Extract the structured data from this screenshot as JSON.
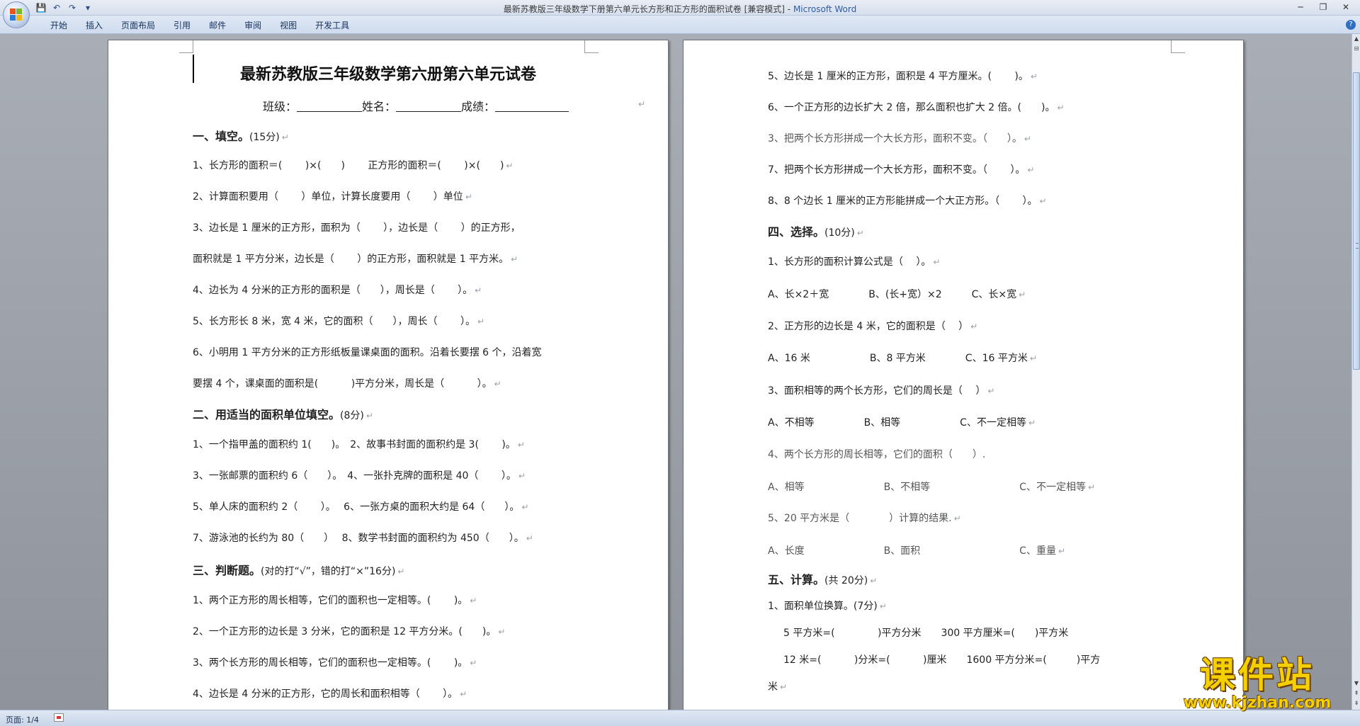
{
  "window": {
    "title": "最新苏教版三年级数学下册第六单元长方形和正方形的面积试卷 [兼容模式]",
    "app_sep": " - ",
    "app_name": "Microsoft Word",
    "qat": [
      "💾",
      "↶",
      "↷",
      "▾"
    ],
    "controls": [
      "─",
      "❐",
      "✕"
    ]
  },
  "ribbon": {
    "tabs": [
      "开始",
      "插入",
      "页面布局",
      "引用",
      "邮件",
      "审阅",
      "视图",
      "开发工具"
    ],
    "help": "?"
  },
  "mark": "↵",
  "left_page": {
    "title": "最新苏教版三年级数学第六册第六单元试卷",
    "info": {
      "class_label": "班级：",
      "name_label": "姓名：",
      "score_label": "成绩："
    },
    "sec1": {
      "title": "一、填空。",
      "note": "(15分)"
    },
    "sec1_items": [
      "1、长方形的面积＝(　　 )×(　　)　　 正方形的面积＝(　　 )×(　　)",
      "2、计算面积要用（　　 ）单位，计算长度要用（　　 ）单位",
      "3、边长是 1 厘米的正方形，面积为（　　 ），边长是（　　 ）的正方形，",
      "面积就是 1 平方分米，边长是（　　 ）的正方形，面积就是 1 平方米。",
      "4、边长为 4 分米的正方形的面积是（　　），周长是（　　 ）。",
      "5、长方形长 8 米，宽 4 米，它的面积（　　），周长（　　 ）。",
      "6、小明用 1 平方分米的正方形纸板量课桌面的面积。沿着长要摆 6 个，沿着宽",
      "要摆 4 个，课桌面的面积是(　　　 )平方分米，周长是（　　　 ）。"
    ],
    "sec2": {
      "title": "二、用适当的面积单位填空。",
      "note": "(8分)"
    },
    "sec2_items": [
      "1、一个指甲盖的面积约 1(　　)。　2、故事书封面的面积约是 3(　　 )。",
      "3、一张邮票的面积约 6（　　）。　4、一张扑克牌的面积是 40（　　 ）。",
      "5、单人床的面积约 2（　　 ）。　 6、一张方桌的面积大约是 64（　　）。",
      "7、游泳池的长约为 80（　　）　 8、数学书封面的面积约为 450（　　）。"
    ],
    "sec3": {
      "title": "三、判断题。",
      "note": "(对的打“√”，错的打“×”16分)"
    },
    "sec3_items": [
      "1、两个正方形的周长相等，它们的面积也一定相等。(　　 )。",
      "2、一个正方形的边长是 3 分米，它的面积是 12 平方分米。(　　)。",
      "3、两个长方形的周长相等，它们的面积也一定相等。(　　 )。",
      "4、边长是 4 分米的正方形，它的周长和面积相等（　　 ）。"
    ]
  },
  "right_page": {
    "sec3_cont": [
      "5、边长是 1 厘米的正方形，面积是 4 平方厘米。(　　 )。",
      "6、一个正方形的边长扩大 2 倍，那么面积也扩大 2 倍。(　　)。",
      "3、把两个长方形拼成一个大长方形，面积不变。（　　）。",
      "7、把两个长方形拼成一个大长方形，面积不变。（　　 ）。",
      "8、8 个边长 1 厘米的正方形能拼成一个大正方形。（　　 ）。"
    ],
    "sec4": {
      "title": "四、选择。",
      "note": "(10分)"
    },
    "sec4_items": [
      "1、长方形的面积计算公式是（　 ）。",
      "A、长×2＋宽　　　　B、(长+宽）×2　　　C、长×宽",
      "2、正方形的边长是 4 米，它的面积是（　 ）",
      "A、16 米　　　　　　B、8 平方米　　　　C、16 平方米",
      "3、面积相等的两个长方形，它们的周长是（　 ）",
      "A、不相等　　　　　B、相等　　　　　　C、不一定相等",
      "4、两个长方形的周长相等，它们的面积（　　）.",
      "A、相等　　　　　　　　B、不相等　　　　　　　　　C、不一定相等",
      "5、20 平方米是（　　　　）计算的结果.",
      "A、长度　　　　　　　　B、面积　　　　　　　　　　C、重量"
    ],
    "sec5": {
      "title": "五、计算。",
      "note": "(共 20分)"
    },
    "sec5_items": [
      "1、面积单位换算。(7分)",
      "5 平方米=(　　　　 )平方分米　　300 平方厘米=(　　)平方米",
      "12 米=(　　　 )分米=(　　　 )厘米　　1600 平方分米=(　　　)平方",
      "米"
    ]
  },
  "statusbar": {
    "page_count": "页面: 1/4"
  },
  "watermark": {
    "big": "课件站",
    "small": "www.kjzhan.com"
  }
}
